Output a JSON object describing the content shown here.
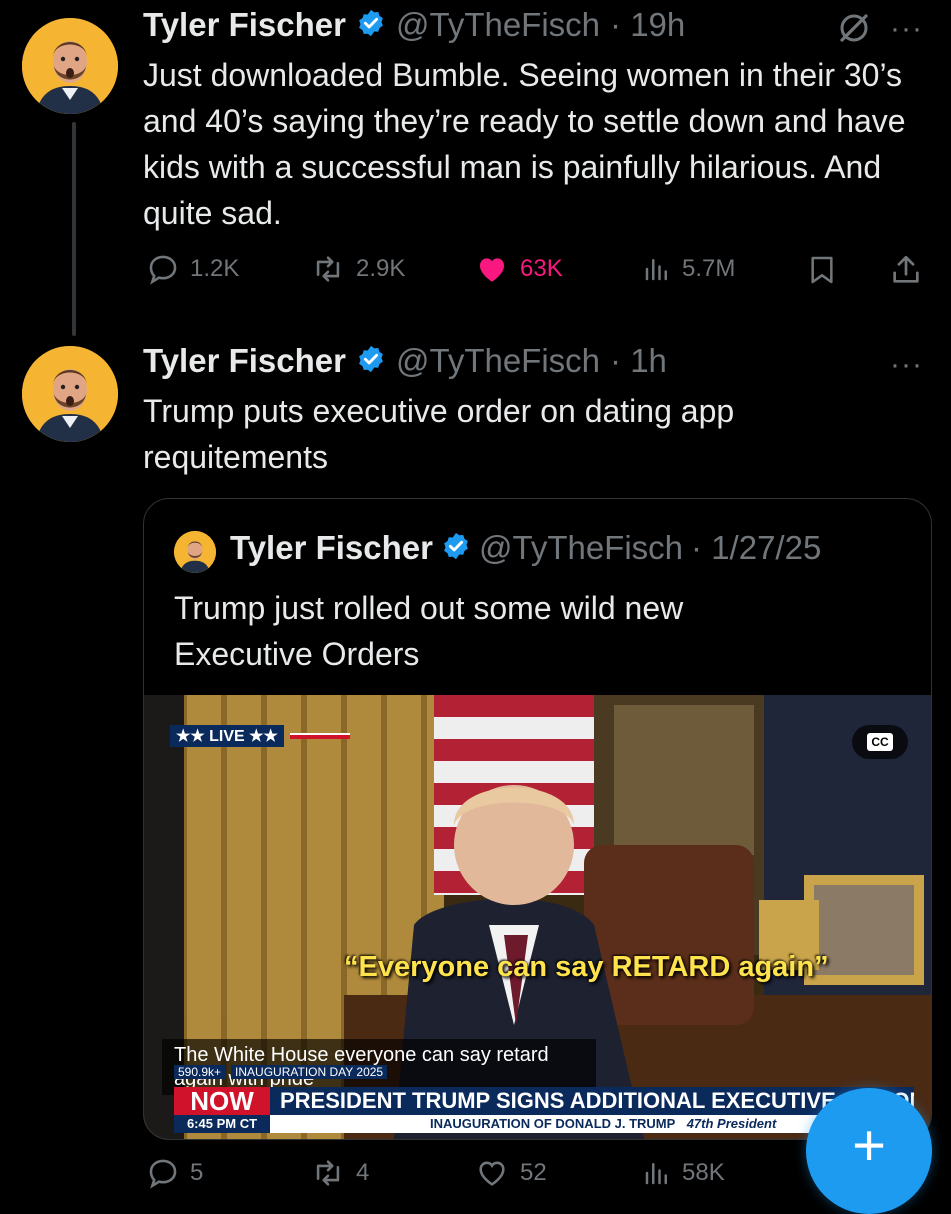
{
  "tweet1": {
    "name": "Tyler Fischer",
    "handle": "@TyTheFisch",
    "time": "· 19h",
    "text": "Just downloaded Bumble. Seeing women in their 30’s and 40’s saying they’re ready to settle down and have kids with a successful man is painfully hilarious. And quite sad.",
    "replies": "1.2K",
    "reposts": "2.9K",
    "likes": "63K",
    "views": "5.7M",
    "more": "···"
  },
  "tweet2": {
    "name": "Tyler Fischer",
    "handle": "@TyTheFisch",
    "time": "· 1h",
    "text": "Trump puts executive order on dating app requitements",
    "replies": "5",
    "reposts": "4",
    "likes": "52",
    "views": "58K",
    "more": "···"
  },
  "quote": {
    "name": "Tyler Fischer",
    "handle": "@TyTheFisch",
    "time": "· 1/27/25",
    "text": "Trump just rolled out some wild new Executive Orders"
  },
  "video": {
    "live_label": "★★ LIVE ★★",
    "cc_label": "CC",
    "caption": "“Everyone can say RETARD again”",
    "subtitle": "The White House everyone can say retard again with pride",
    "views_badge": "590.9k+",
    "inaug_tag": "INAUGURATION DAY 2025",
    "now_label": "NOW",
    "time_label": "6:45 PM CT",
    "headline": "PRESIDENT TRUMP SIGNS ADDITIONAL EXECUTIVE ACTION",
    "ticker": "INAUGURATION OF DONALD J. TRUMP",
    "ticker_script": "47th President"
  },
  "fab": {
    "label": "+"
  },
  "colors": {
    "accent": "#1d9bf0",
    "like": "#f91880",
    "muted": "#71767b",
    "text": "#e7e9ea"
  }
}
